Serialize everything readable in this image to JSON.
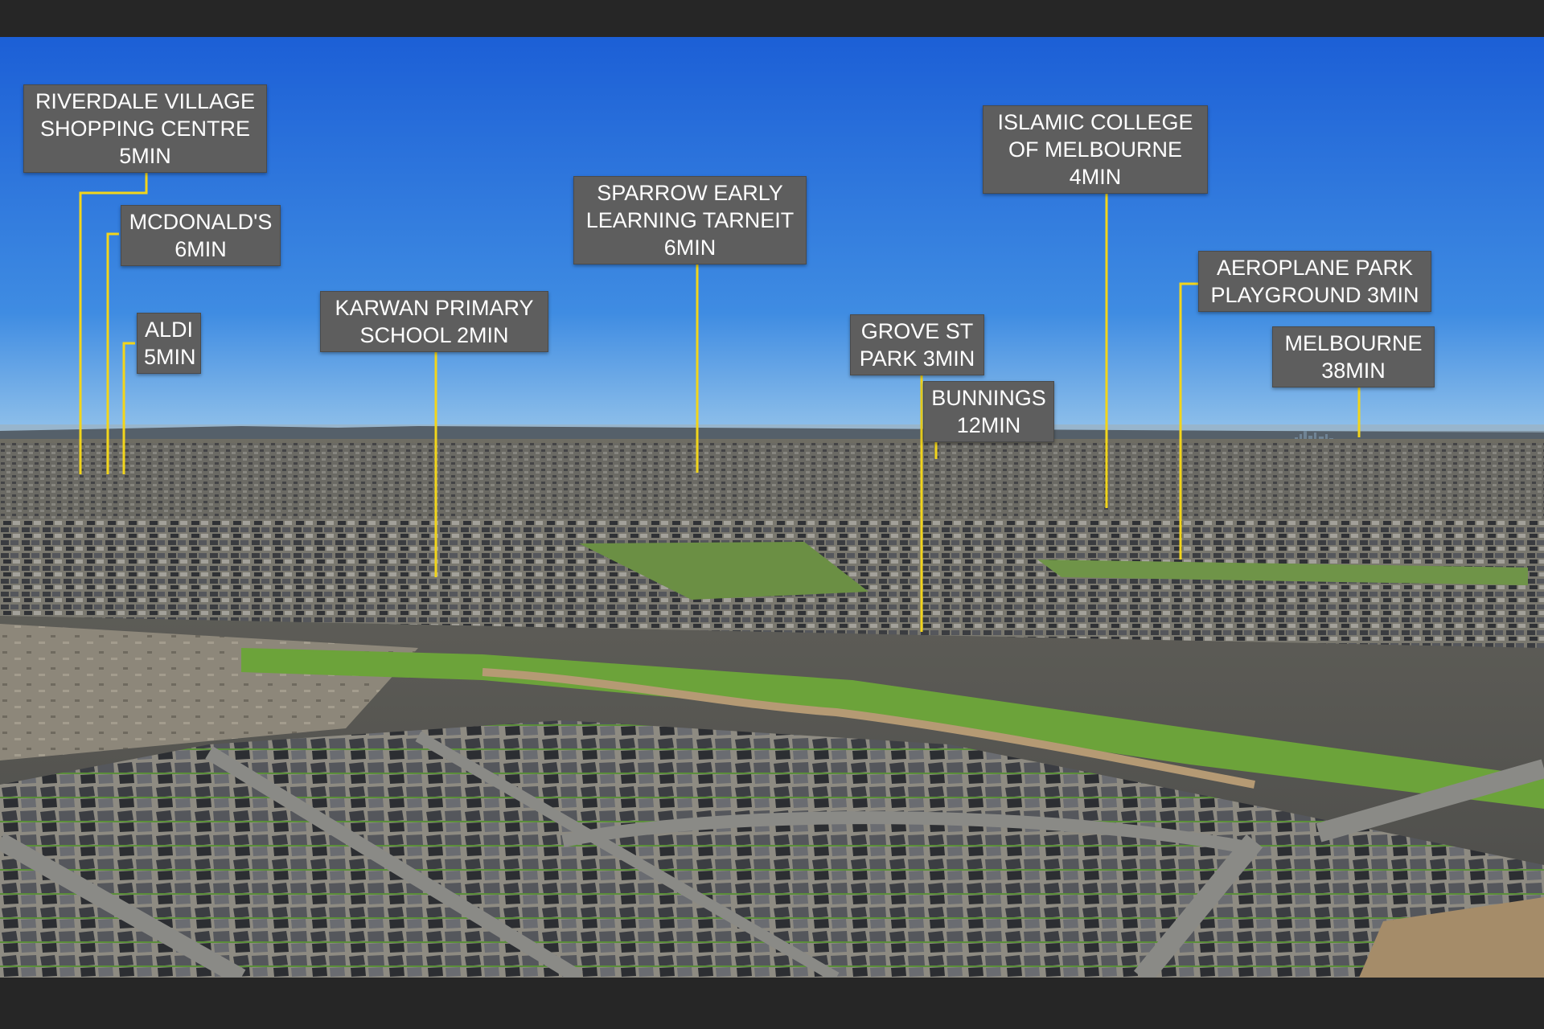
{
  "image": {
    "description_free": true,
    "palette": {
      "sky_top": "#1c60d8",
      "sky_horizon": "#5aa3e6",
      "label_bg": "#5e5e5e",
      "label_text": "#ffffff",
      "leader_line": "#f2d51b",
      "letterbox": "#262626"
    }
  },
  "labels": [
    {
      "id": "riverdale",
      "lines": [
        "RIVERDALE VILLAGE",
        "SHOPPING CENTRE",
        "5MIN"
      ]
    },
    {
      "id": "mcdonalds",
      "lines": [
        "MCDONALD'S",
        "6MIN"
      ]
    },
    {
      "id": "aldi",
      "lines": [
        "ALDI",
        "5MIN"
      ]
    },
    {
      "id": "karwan",
      "lines": [
        "KARWAN PRIMARY",
        "SCHOOL 2MIN"
      ]
    },
    {
      "id": "sparrow",
      "lines": [
        "SPARROW EARLY",
        "LEARNING TARNEIT",
        "6MIN"
      ]
    },
    {
      "id": "grove",
      "lines": [
        "GROVE ST",
        "PARK 3MIN"
      ]
    },
    {
      "id": "bunnings",
      "lines": [
        "BUNNINGS",
        "12MIN"
      ]
    },
    {
      "id": "islamic",
      "lines": [
        "ISLAMIC COLLEGE",
        "OF MELBOURNE",
        "4MIN"
      ]
    },
    {
      "id": "aeroplane",
      "lines": [
        "AEROPLANE PARK",
        "PLAYGROUND 3MIN"
      ]
    },
    {
      "id": "melbourne",
      "lines": [
        "MELBOURNE",
        "38MIN"
      ]
    }
  ]
}
